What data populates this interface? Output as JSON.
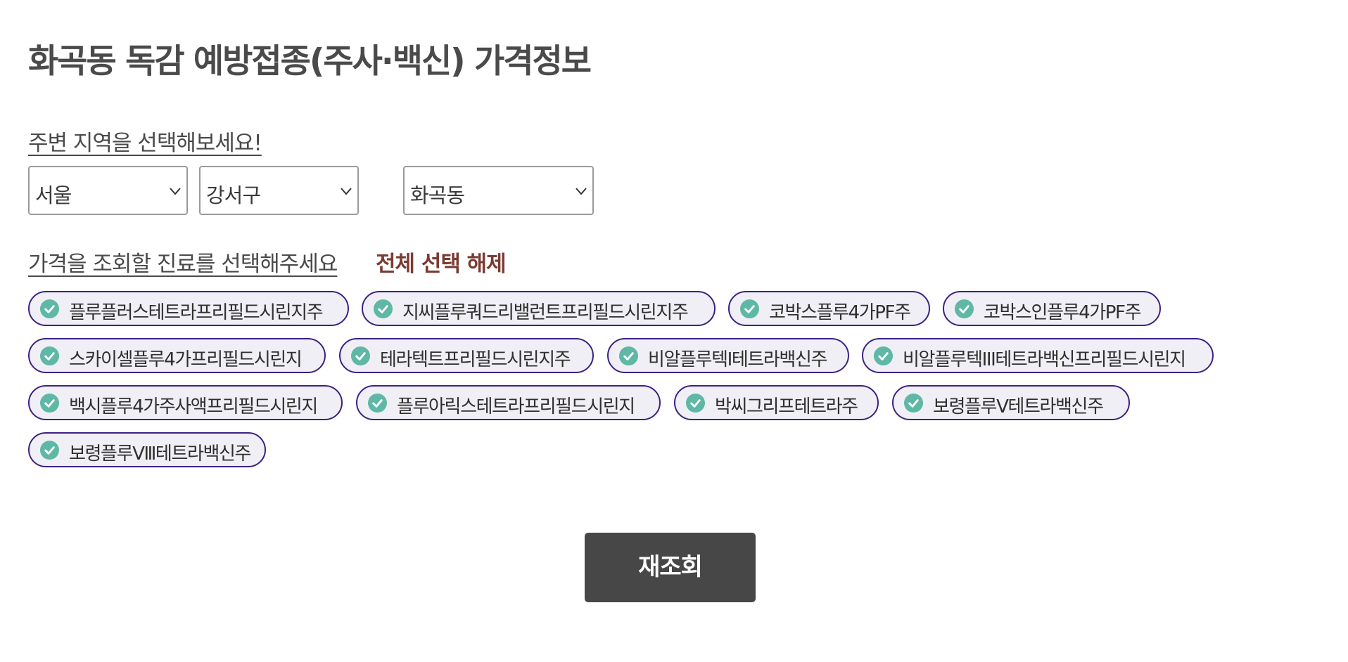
{
  "page_title": "화곡동 독감 예방접종(주사·백신) 가격정보",
  "region": {
    "label": "주변 지역을 선택해보세요!",
    "selects": [
      {
        "value": "서울"
      },
      {
        "value": "강서구"
      },
      {
        "value": "화곡동"
      }
    ]
  },
  "treatments": {
    "label": "가격을 조회할 진료를 선택해주세요",
    "clear_all_label": "전체 선택 해제",
    "chips": [
      {
        "label": "플루플러스테트라프리필드시린지주",
        "selected": true
      },
      {
        "label": "지씨플루쿼드리밸런트프리필드시린지주",
        "selected": true
      },
      {
        "label": "코박스플루4가PF주",
        "selected": true
      },
      {
        "label": "코박스인플루4가PF주",
        "selected": true
      },
      {
        "label": "스카이셀플루4가프리필드시린지",
        "selected": true
      },
      {
        "label": "테라텍트프리필드시린지주",
        "selected": true
      },
      {
        "label": "비알플루텍I테트라백신주",
        "selected": true
      },
      {
        "label": "비알플루텍III테트라백신프리필드시린지",
        "selected": true
      },
      {
        "label": "백시플루4가주사액프리필드시린지",
        "selected": true
      },
      {
        "label": "플루아릭스테트라프리필드시린지",
        "selected": true
      },
      {
        "label": "박씨그리프테트라주",
        "selected": true
      },
      {
        "label": "보령플루Ⅴ테트라백신주",
        "selected": true
      },
      {
        "label": "보령플루Ⅷ테트라백신주",
        "selected": true
      }
    ]
  },
  "refresh_button_label": "재조회",
  "colors": {
    "chip_border": "#3b2182",
    "chip_bg": "#f1eff6",
    "check": "#5fb8a6",
    "clear_all": "#7a3b33",
    "button_bg": "#474747"
  },
  "icons": {
    "select_chevron": "chevron-down-icon",
    "chip_check": "check-circle-icon"
  }
}
